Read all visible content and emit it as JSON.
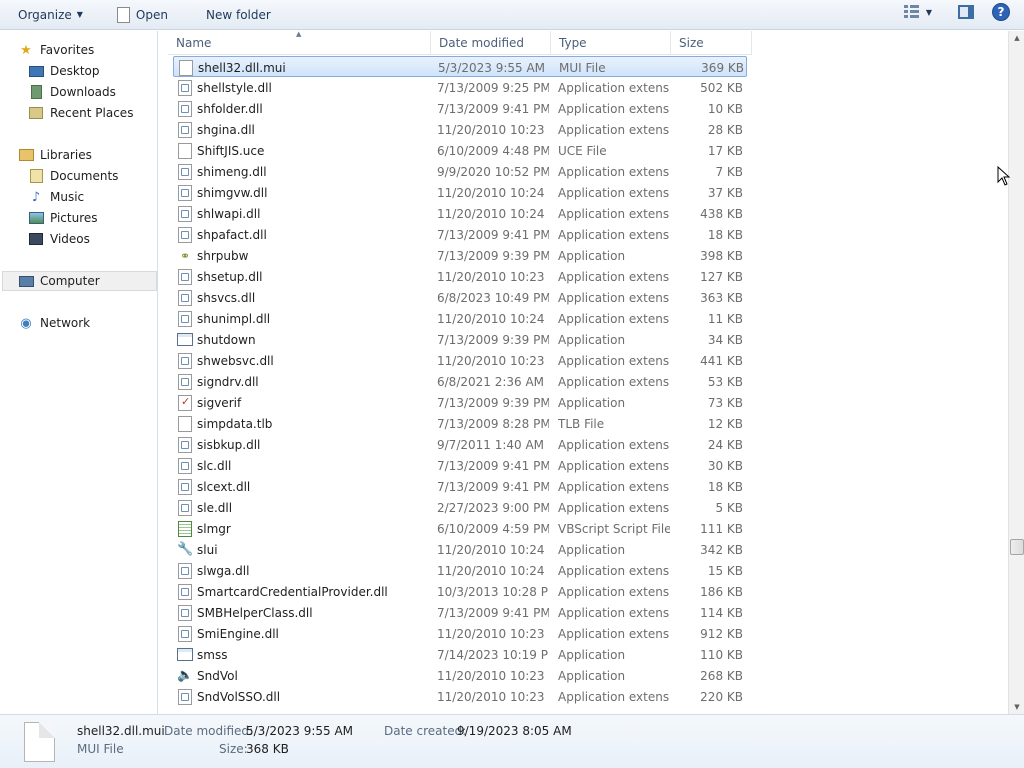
{
  "toolbar": {
    "organize_label": "Organize",
    "open_label": "Open",
    "new_folder_label": "New folder"
  },
  "nav": {
    "favorites": {
      "label": "Favorites",
      "items": [
        "Desktop",
        "Downloads",
        "Recent Places"
      ]
    },
    "libraries": {
      "label": "Libraries",
      "items": [
        "Documents",
        "Music",
        "Pictures",
        "Videos"
      ]
    },
    "computer_label": "Computer",
    "network_label": "Network"
  },
  "columns": {
    "name": "Name",
    "date_modified": "Date modified",
    "type": "Type",
    "size": "Size"
  },
  "files": [
    {
      "name": "shell32.dll.mui",
      "date": "5/3/2023 9:55 AM",
      "type": "MUI File",
      "size": "369 KB",
      "icon": "blank-file-icon"
    },
    {
      "name": "shellstyle.dll",
      "date": "7/13/2009 9:25 PM",
      "type": "Application extens...",
      "size": "502 KB",
      "icon": "dll-icon"
    },
    {
      "name": "shfolder.dll",
      "date": "7/13/2009 9:41 PM",
      "type": "Application extens...",
      "size": "10 KB",
      "icon": "dll-icon"
    },
    {
      "name": "shgina.dll",
      "date": "11/20/2010 10:23 ...",
      "type": "Application extens...",
      "size": "28 KB",
      "icon": "dll-icon"
    },
    {
      "name": "ShiftJIS.uce",
      "date": "6/10/2009 4:48 PM",
      "type": "UCE File",
      "size": "17 KB",
      "icon": "blank-file-icon"
    },
    {
      "name": "shimeng.dll",
      "date": "9/9/2020 10:52 PM",
      "type": "Application extens...",
      "size": "7 KB",
      "icon": "dll-icon"
    },
    {
      "name": "shimgvw.dll",
      "date": "11/20/2010 10:24 ...",
      "type": "Application extens...",
      "size": "37 KB",
      "icon": "dll-icon"
    },
    {
      "name": "shlwapi.dll",
      "date": "11/20/2010 10:24 ...",
      "type": "Application extens...",
      "size": "438 KB",
      "icon": "dll-icon"
    },
    {
      "name": "shpafact.dll",
      "date": "7/13/2009 9:41 PM",
      "type": "Application extens...",
      "size": "18 KB",
      "icon": "dll-icon"
    },
    {
      "name": "shrpubw",
      "date": "7/13/2009 9:39 PM",
      "type": "Application",
      "size": "398 KB",
      "icon": "share-wizard-icon"
    },
    {
      "name": "shsetup.dll",
      "date": "11/20/2010 10:23 ...",
      "type": "Application extens...",
      "size": "127 KB",
      "icon": "dll-icon"
    },
    {
      "name": "shsvcs.dll",
      "date": "6/8/2023 10:49 PM",
      "type": "Application extens...",
      "size": "363 KB",
      "icon": "dll-icon"
    },
    {
      "name": "shunimpl.dll",
      "date": "11/20/2010 10:24 ...",
      "type": "Application extens...",
      "size": "11 KB",
      "icon": "dll-icon"
    },
    {
      "name": "shutdown",
      "date": "7/13/2009 9:39 PM",
      "type": "Application",
      "size": "34 KB",
      "icon": "app-icon"
    },
    {
      "name": "shwebsvc.dll",
      "date": "11/20/2010 10:23 ...",
      "type": "Application extens...",
      "size": "441 KB",
      "icon": "dll-icon"
    },
    {
      "name": "signdrv.dll",
      "date": "6/8/2021 2:36 AM",
      "type": "Application extens...",
      "size": "53 KB",
      "icon": "dll-icon"
    },
    {
      "name": "sigverif",
      "date": "7/13/2009 9:39 PM",
      "type": "Application",
      "size": "73 KB",
      "icon": "sigverif-icon"
    },
    {
      "name": "simpdata.tlb",
      "date": "7/13/2009 8:28 PM",
      "type": "TLB File",
      "size": "12 KB",
      "icon": "blank-file-icon"
    },
    {
      "name": "sisbkup.dll",
      "date": "9/7/2011 1:40 AM",
      "type": "Application extens...",
      "size": "24 KB",
      "icon": "dll-icon"
    },
    {
      "name": "slc.dll",
      "date": "7/13/2009 9:41 PM",
      "type": "Application extens...",
      "size": "30 KB",
      "icon": "dll-icon"
    },
    {
      "name": "slcext.dll",
      "date": "7/13/2009 9:41 PM",
      "type": "Application extens...",
      "size": "18 KB",
      "icon": "dll-icon"
    },
    {
      "name": "sle.dll",
      "date": "2/27/2023 9:00 PM",
      "type": "Application extens...",
      "size": "5 KB",
      "icon": "dll-icon"
    },
    {
      "name": "slmgr",
      "date": "6/10/2009 4:59 PM",
      "type": "VBScript Script File",
      "size": "111 KB",
      "icon": "vbscript-icon"
    },
    {
      "name": "slui",
      "date": "11/20/2010 10:24 ...",
      "type": "Application",
      "size": "342 KB",
      "icon": "keys-icon"
    },
    {
      "name": "slwga.dll",
      "date": "11/20/2010 10:24 ...",
      "type": "Application extens...",
      "size": "15 KB",
      "icon": "dll-icon"
    },
    {
      "name": "SmartcardCredentialProvider.dll",
      "date": "10/3/2013 10:28 PM",
      "type": "Application extens...",
      "size": "186 KB",
      "icon": "dll-icon"
    },
    {
      "name": "SMBHelperClass.dll",
      "date": "7/13/2009 9:41 PM",
      "type": "Application extens...",
      "size": "114 KB",
      "icon": "dll-icon"
    },
    {
      "name": "SmiEngine.dll",
      "date": "11/20/2010 10:23 ...",
      "type": "Application extens...",
      "size": "912 KB",
      "icon": "dll-icon"
    },
    {
      "name": "smss",
      "date": "7/14/2023 10:19 PM",
      "type": "Application",
      "size": "110 KB",
      "icon": "app-icon"
    },
    {
      "name": "SndVol",
      "date": "11/20/2010 10:23 ...",
      "type": "Application",
      "size": "268 KB",
      "icon": "speaker-icon"
    },
    {
      "name": "SndVolSSO.dll",
      "date": "11/20/2010 10:23 ...",
      "type": "Application extens...",
      "size": "220 KB",
      "icon": "dll-icon"
    }
  ],
  "details": {
    "file_name": "shell32.dll.mui",
    "file_type": "MUI File",
    "date_modified_label": "Date modified:",
    "date_modified_value": "5/3/2023 9:55 AM",
    "size_label": "Size:",
    "size_value": "368 KB",
    "date_created_label": "Date created:",
    "date_created_value": "9/19/2023 8:05 AM"
  }
}
